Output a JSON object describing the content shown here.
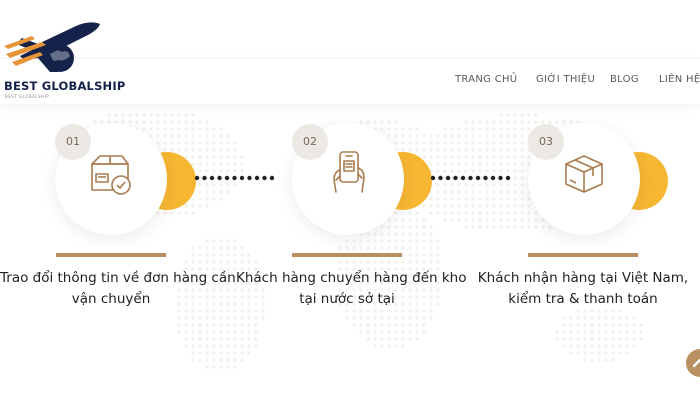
{
  "brand": {
    "name": "BEST GLOBALSHIP",
    "tagline": "BEST GLOBALSHIP"
  },
  "nav": {
    "items": [
      "TRANG CHỦ",
      "GIỚI THIỆU",
      "BLOG",
      "LIÊN HỆ"
    ]
  },
  "steps": [
    {
      "number": "01",
      "icon": "package-check-icon",
      "line1": "Trao đổi thông tin về đơn hàng cần",
      "line2": "vận chuyển"
    },
    {
      "number": "02",
      "icon": "phone-in-hand-icon",
      "line1": "Khách hàng chuyển hàng đến kho",
      "line2": "tại nước sở tại"
    },
    {
      "number": "03",
      "icon": "box-icon",
      "line1": "Khách nhận hàng tại Việt Nam,",
      "line2": "kiểm tra & thanh toán"
    }
  ],
  "colors": {
    "accent": "#b89062",
    "yellow": "#f7b733",
    "navy": "#15224a",
    "logo_orange": "#e8953a"
  }
}
